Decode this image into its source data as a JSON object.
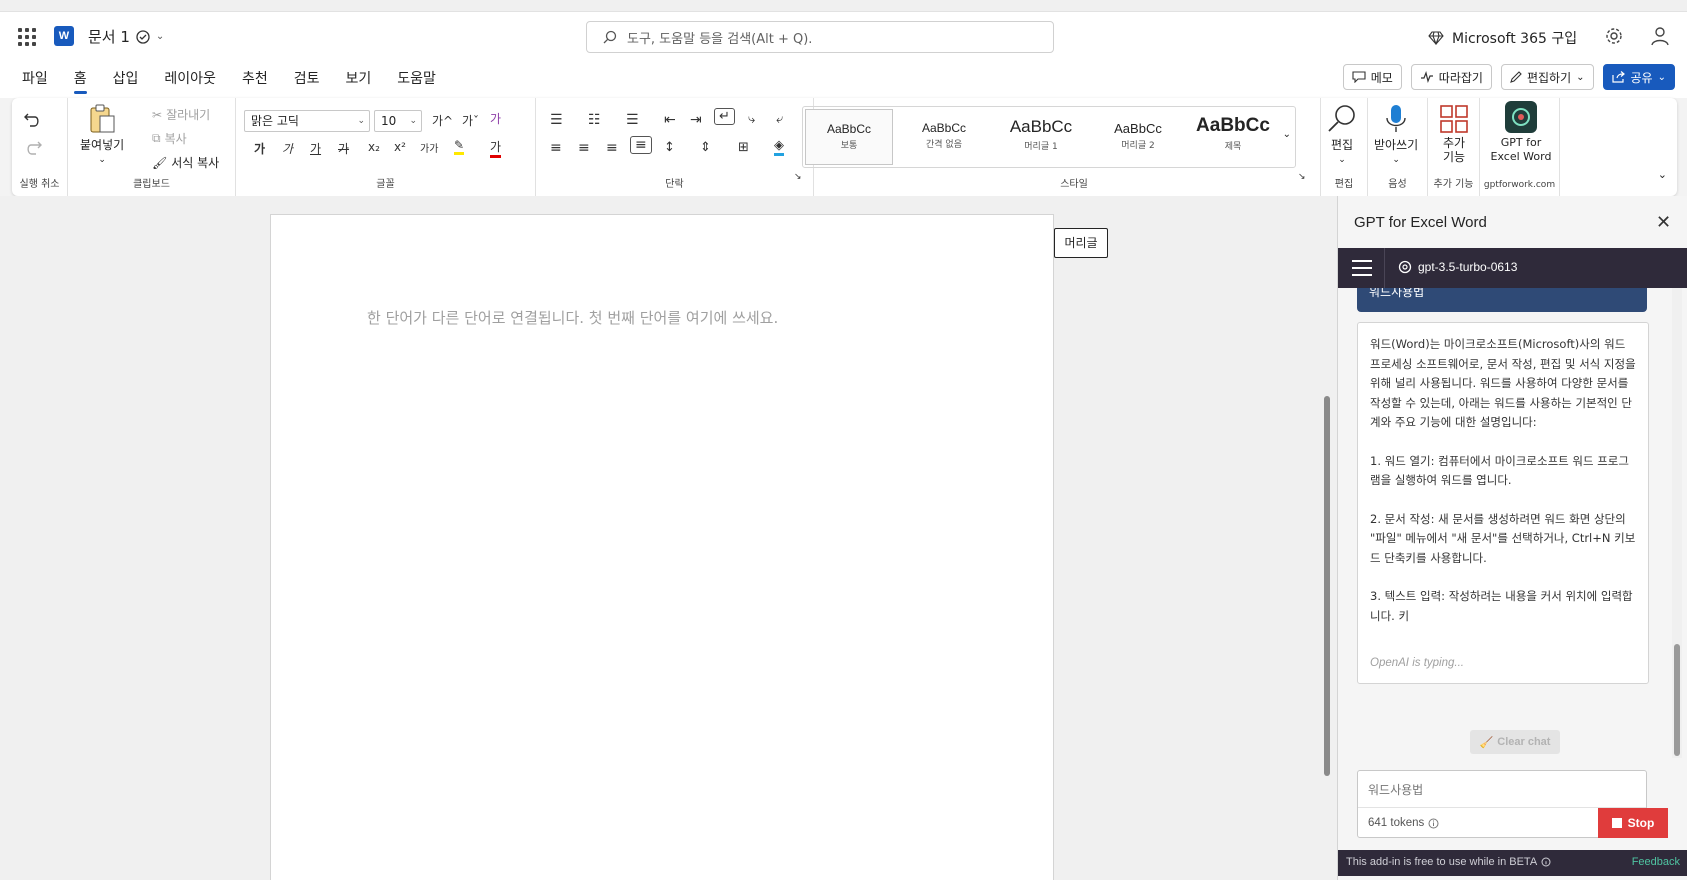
{
  "app": {
    "doc_title": "문서 1",
    "search_placeholder": "도구, 도움말 등을 검색(Alt + Q).",
    "ms365_label": "Microsoft 365 구입"
  },
  "menu": {
    "tabs": [
      "파일",
      "홈",
      "삽입",
      "레이아웃",
      "추천",
      "검토",
      "보기",
      "도움말"
    ],
    "active_tab": "홈",
    "memo": "메모",
    "catch_up": "따라잡기",
    "editing": "편집하기",
    "share": "공유"
  },
  "ribbon": {
    "undo_group": "실행 취소",
    "clipboard": {
      "label": "클립보드",
      "paste": "붙여넣기",
      "cut": "잘라내기",
      "copy": "복사",
      "format_painter": "서식 복사"
    },
    "font": {
      "label": "글꼴",
      "font_name": "맑은 고딕",
      "font_size": "10",
      "grow": "가^",
      "shrink": "가ˇ",
      "bold": "가",
      "italic": "가",
      "underline": "가",
      "strike": "가",
      "sub": "x₂",
      "sup": "x²",
      "case": "가가",
      "color": "가"
    },
    "paragraph": {
      "label": "단락"
    },
    "styles": {
      "label": "스타일",
      "items": [
        {
          "preview": "AaBbCc",
          "name": "보통"
        },
        {
          "preview": "AaBbCc",
          "name": "간격 없음"
        },
        {
          "preview": "AaBbCc",
          "name": "머리글 1"
        },
        {
          "preview": "AaBbCc",
          "name": "머리글 2"
        },
        {
          "preview": "AaBbCc",
          "name": "제목"
        }
      ]
    },
    "edit": {
      "btn": "편집",
      "label": "편집"
    },
    "voice": {
      "btn": "받아쓰기",
      "label": "음성"
    },
    "addins": {
      "btn": "추가 기능",
      "label": "추가 기능"
    },
    "gpt": {
      "btn": "GPT for Excel Word",
      "label": "gptforwork.com"
    }
  },
  "document": {
    "placeholder": "한 단어가 다른 단어로 연결됩니다. 첫 번째 단어를 여기에 쓰세요.",
    "header_tag": "머리글"
  },
  "pane": {
    "title": "GPT for Excel Word",
    "model": "gpt-3.5-turbo-0613",
    "user_message": "워드사용법",
    "response": [
      "워드(Word)는 마이크로소프트(Microsoft)사의 워드 프로세싱 소프트웨어로, 문서 작성, 편집 및 서식 지정을 위해 널리 사용됩니다. 워드를 사용하여 다양한 문서를 작성할 수 있는데, 아래는 워드를 사용하는 기본적인 단계와 주요 기능에 대한 설명입니다:",
      "1. 워드 열기: 컴퓨터에서 마이크로소프트 워드 프로그램을 실행하여 워드를 엽니다.",
      "2. 문서 작성: 새 문서를 생성하려면 워드 화면 상단의 \"파일\" 메뉴에서 \"새 문서\"를 선택하거나, Ctrl+N 키보드 단축키를 사용합니다.",
      "3. 텍스트 입력: 작성하려는 내용을 커서 위치에 입력합니다. 키"
    ],
    "typing": "OpenAI is typing...",
    "clear_chat": "Clear chat",
    "input_value": "워드사용법",
    "tokens": "641 tokens",
    "stop": "Stop",
    "beta_note": "This add-in is free to use while in BETA",
    "feedback": "Feedback"
  }
}
